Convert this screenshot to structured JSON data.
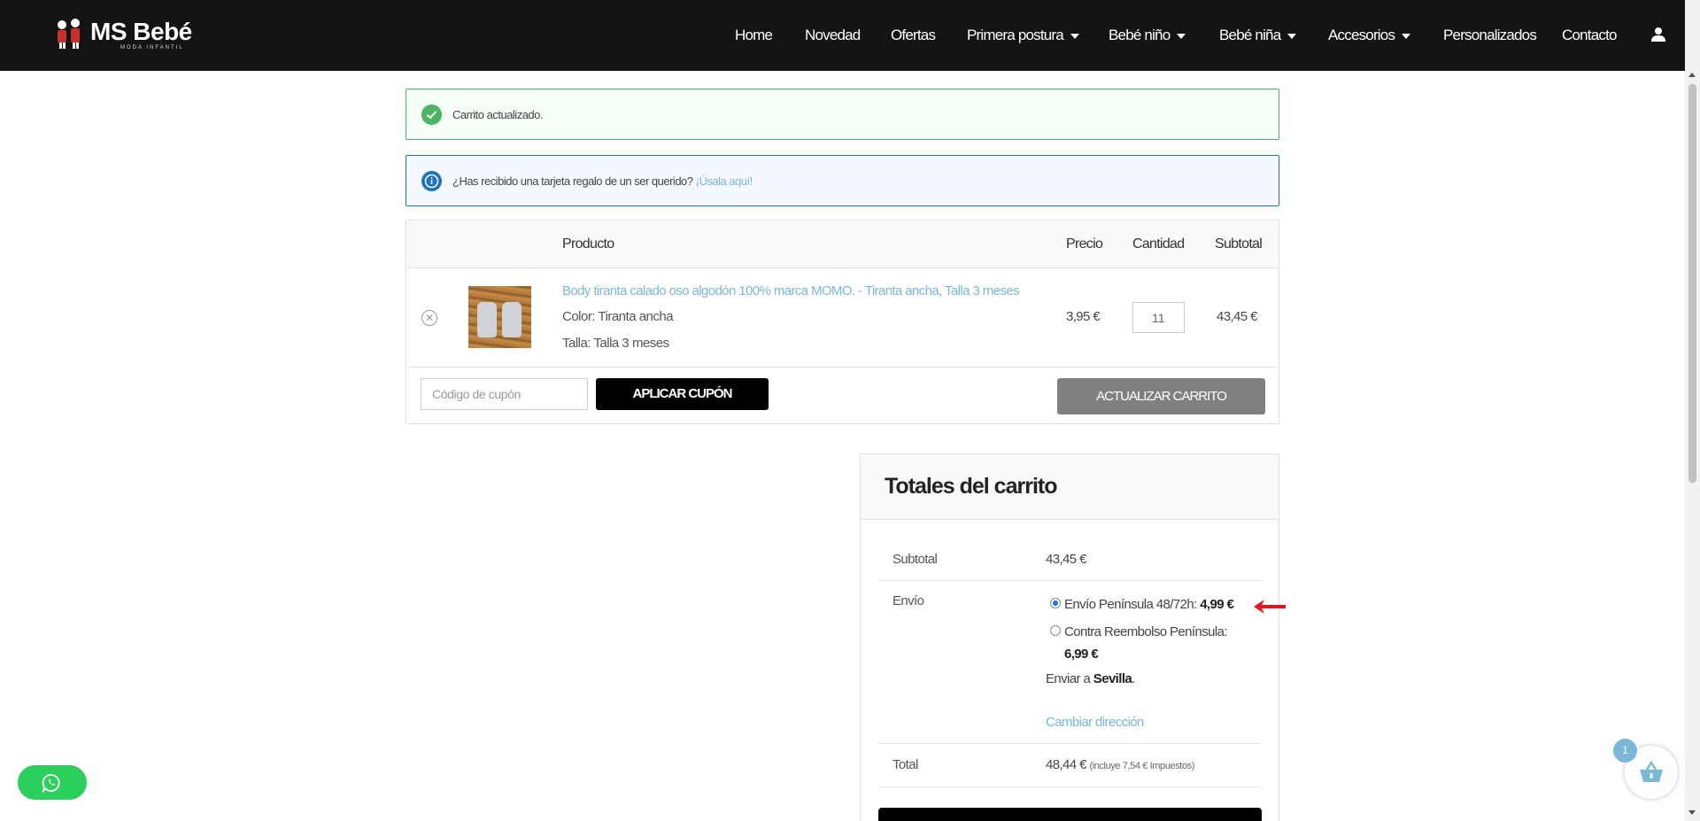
{
  "header": {
    "logo_text": "MS Bebé",
    "logo_sub": "MODA INFANTIL",
    "nav": [
      {
        "label": "Home"
      },
      {
        "label": "Novedad"
      },
      {
        "label": "Ofertas"
      },
      {
        "label": "Primera postura"
      },
      {
        "label": "Bebé niño"
      },
      {
        "label": "Bebé niña"
      },
      {
        "label": "Accesorios"
      },
      {
        "label": "Personalizados"
      },
      {
        "label": "Contacto"
      }
    ]
  },
  "notices": {
    "success": "Carrito actualizado.",
    "info_text": "¿Has recibido una tarjeta regalo de un ser querido? ",
    "info_link": "¡Úsala aquí!"
  },
  "cart": {
    "headers": {
      "product": "Producto",
      "price": "Precio",
      "quantity": "Cantidad",
      "subtotal": "Subtotal"
    },
    "item": {
      "name": "Body tiranta calado oso algodón 100% marca MOMO. - Tiranta ancha, Talla 3 meses",
      "color": "Color: Tiranta ancha",
      "size": "Talla: Talla 3 meses",
      "price": "3,95 €",
      "quantity": "11",
      "subtotal": "43,45 €"
    },
    "coupon_placeholder": "Código de cupón",
    "apply_coupon": "APLICAR CUPÓN",
    "update_cart": "ACTUALIZAR CARRITO"
  },
  "totals": {
    "title": "Totales del carrito",
    "subtotal_label": "Subtotal",
    "subtotal_value": "43,45 €",
    "shipping_label": "Envío",
    "option1_text": "Envío Península 48/72h: ",
    "option1_price": "4,99 €",
    "option2_text": "Contra Reembolso Península:",
    "option2_price": "6,99 €",
    "ship_to_text": "Enviar a ",
    "ship_to_city": "Sevilla",
    "ship_to_dot": ".",
    "change_address": "Cambiar dirección",
    "total_label": "Total",
    "total_value": "48,44 €",
    "tax_note": "(incluye 7,54 € Impuestos)"
  },
  "floating": {
    "cart_count": "1"
  },
  "colors": {
    "accent_link": "#7ab7d8",
    "success": "#4bb564",
    "info": "#1e73be",
    "whatsapp": "#2bcf5c"
  }
}
